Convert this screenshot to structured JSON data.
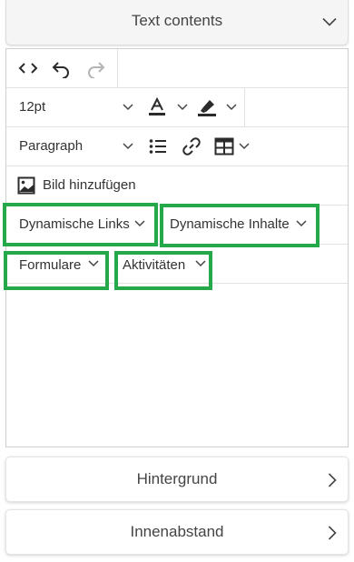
{
  "panel": {
    "title": "Text contents"
  },
  "toolbar": {
    "source_icon": "code-icon",
    "undo_icon": "undo-icon",
    "redo_icon": "redo-icon",
    "font_size": "12pt",
    "text_color_icon": "text-color-icon",
    "highlight_icon": "highlight-icon",
    "block_format": "Paragraph",
    "list_icon": "bullet-list-icon",
    "link_icon": "link-icon",
    "table_icon": "table-icon",
    "add_image_label": "Bild hinzufügen",
    "dynamic_links_label": "Dynamische Links",
    "dynamic_content_label": "Dynamische Inhalte",
    "forms_label": "Formulare",
    "activities_label": "Aktivitäten"
  },
  "sections": {
    "background": "Hintergrund",
    "padding": "Innenabstand"
  },
  "colors": {
    "highlight_box": "#25a84a",
    "icon": "#2b2b2b",
    "disabled_icon": "#b5b5b5"
  }
}
